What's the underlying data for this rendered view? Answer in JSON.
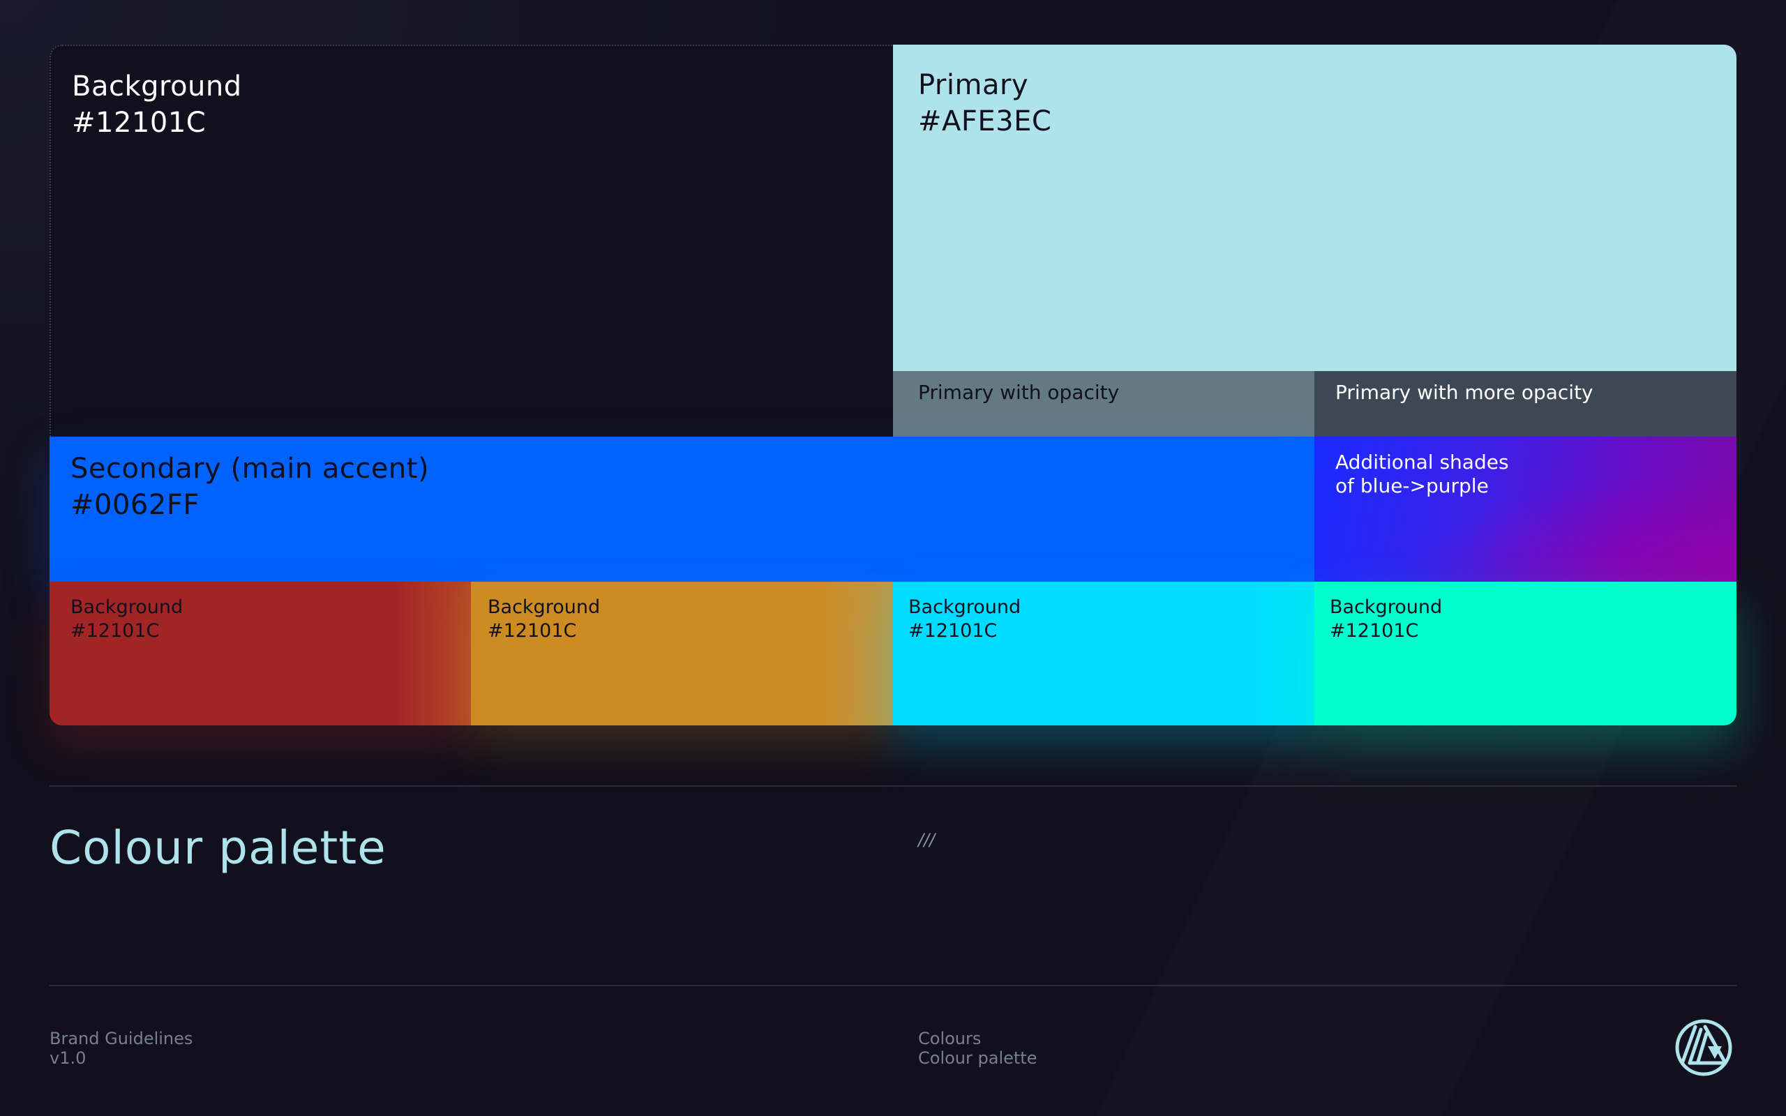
{
  "palette": {
    "background": {
      "name": "Background",
      "hex": "#12101C"
    },
    "primary": {
      "name": "Primary",
      "hex": "#AFE3EC"
    },
    "primary_opacity": {
      "label": "Primary with opacity"
    },
    "primary_more_opacity": {
      "label": "Primary with more opacity"
    },
    "secondary": {
      "name": "Secondary (main accent)",
      "hex": "#0062FF"
    },
    "additional_shades": {
      "line1": "Additional shades",
      "line2": "of blue->purple"
    },
    "bottom_row": [
      {
        "name": "Background",
        "hex": "#12101C",
        "color": "#A22525"
      },
      {
        "name": "Background",
        "hex": "#12101C",
        "color": "#CD8B24"
      },
      {
        "name": "Background",
        "hex": "#12101C",
        "color": "#00DCFF"
      },
      {
        "name": "Background",
        "hex": "#12101C",
        "color": "#00FFCC"
      }
    ]
  },
  "section": {
    "title": "Colour palette",
    "marker": "///"
  },
  "footer": {
    "doc_title": "Brand Guidelines",
    "version": "v1.0",
    "section": "Colours",
    "subsection": "Colour palette",
    "logo_icon": "brand-logo-icon"
  }
}
